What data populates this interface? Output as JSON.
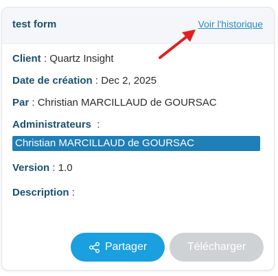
{
  "header": {
    "title": "test form",
    "history_link": "Voir l'historique"
  },
  "details": {
    "client_label": "Client",
    "client_value": "Quartz Insight",
    "date_label": "Date de création",
    "date_value": "Dec 2, 2025",
    "by_label": "Par",
    "by_value": "Christian MARCILLAUD de GOURSAC",
    "admins_label": "Administrateurs",
    "admins": [
      "Christian MARCILLAUD de GOURSAC"
    ],
    "version_label": "Version",
    "version_value": "1.0",
    "description_label": "Description",
    "description_value": ""
  },
  "actions": {
    "share_label": "Partager",
    "download_label": "Télécharger"
  },
  "icons": {
    "share": "share-icon",
    "annotation_arrow": "red-arrow-icon"
  },
  "colors": {
    "primary": "#1a9fe0",
    "label": "#1b4f6d",
    "admin_pill": "#1f7fb6",
    "disabled": "#cfd2d5",
    "annotation": "#e02020"
  }
}
